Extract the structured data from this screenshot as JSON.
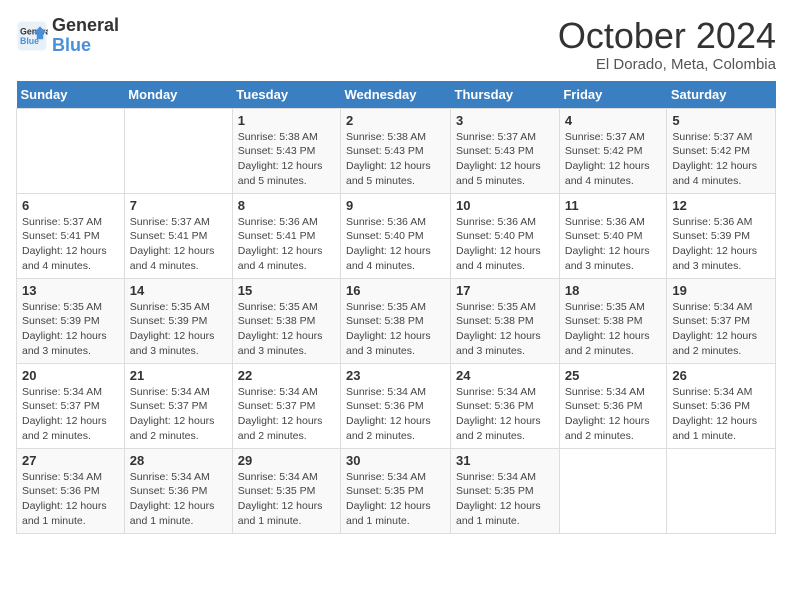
{
  "logo": {
    "line1": "General",
    "line2": "Blue"
  },
  "title": "October 2024",
  "location": "El Dorado, Meta, Colombia",
  "days_of_week": [
    "Sunday",
    "Monday",
    "Tuesday",
    "Wednesday",
    "Thursday",
    "Friday",
    "Saturday"
  ],
  "weeks": [
    [
      {
        "day": "",
        "info": ""
      },
      {
        "day": "",
        "info": ""
      },
      {
        "day": "1",
        "info": "Sunrise: 5:38 AM\nSunset: 5:43 PM\nDaylight: 12 hours and 5 minutes."
      },
      {
        "day": "2",
        "info": "Sunrise: 5:38 AM\nSunset: 5:43 PM\nDaylight: 12 hours and 5 minutes."
      },
      {
        "day": "3",
        "info": "Sunrise: 5:37 AM\nSunset: 5:43 PM\nDaylight: 12 hours and 5 minutes."
      },
      {
        "day": "4",
        "info": "Sunrise: 5:37 AM\nSunset: 5:42 PM\nDaylight: 12 hours and 4 minutes."
      },
      {
        "day": "5",
        "info": "Sunrise: 5:37 AM\nSunset: 5:42 PM\nDaylight: 12 hours and 4 minutes."
      }
    ],
    [
      {
        "day": "6",
        "info": "Sunrise: 5:37 AM\nSunset: 5:41 PM\nDaylight: 12 hours and 4 minutes."
      },
      {
        "day": "7",
        "info": "Sunrise: 5:37 AM\nSunset: 5:41 PM\nDaylight: 12 hours and 4 minutes."
      },
      {
        "day": "8",
        "info": "Sunrise: 5:36 AM\nSunset: 5:41 PM\nDaylight: 12 hours and 4 minutes."
      },
      {
        "day": "9",
        "info": "Sunrise: 5:36 AM\nSunset: 5:40 PM\nDaylight: 12 hours and 4 minutes."
      },
      {
        "day": "10",
        "info": "Sunrise: 5:36 AM\nSunset: 5:40 PM\nDaylight: 12 hours and 4 minutes."
      },
      {
        "day": "11",
        "info": "Sunrise: 5:36 AM\nSunset: 5:40 PM\nDaylight: 12 hours and 3 minutes."
      },
      {
        "day": "12",
        "info": "Sunrise: 5:36 AM\nSunset: 5:39 PM\nDaylight: 12 hours and 3 minutes."
      }
    ],
    [
      {
        "day": "13",
        "info": "Sunrise: 5:35 AM\nSunset: 5:39 PM\nDaylight: 12 hours and 3 minutes."
      },
      {
        "day": "14",
        "info": "Sunrise: 5:35 AM\nSunset: 5:39 PM\nDaylight: 12 hours and 3 minutes."
      },
      {
        "day": "15",
        "info": "Sunrise: 5:35 AM\nSunset: 5:38 PM\nDaylight: 12 hours and 3 minutes."
      },
      {
        "day": "16",
        "info": "Sunrise: 5:35 AM\nSunset: 5:38 PM\nDaylight: 12 hours and 3 minutes."
      },
      {
        "day": "17",
        "info": "Sunrise: 5:35 AM\nSunset: 5:38 PM\nDaylight: 12 hours and 3 minutes."
      },
      {
        "day": "18",
        "info": "Sunrise: 5:35 AM\nSunset: 5:38 PM\nDaylight: 12 hours and 2 minutes."
      },
      {
        "day": "19",
        "info": "Sunrise: 5:34 AM\nSunset: 5:37 PM\nDaylight: 12 hours and 2 minutes."
      }
    ],
    [
      {
        "day": "20",
        "info": "Sunrise: 5:34 AM\nSunset: 5:37 PM\nDaylight: 12 hours and 2 minutes."
      },
      {
        "day": "21",
        "info": "Sunrise: 5:34 AM\nSunset: 5:37 PM\nDaylight: 12 hours and 2 minutes."
      },
      {
        "day": "22",
        "info": "Sunrise: 5:34 AM\nSunset: 5:37 PM\nDaylight: 12 hours and 2 minutes."
      },
      {
        "day": "23",
        "info": "Sunrise: 5:34 AM\nSunset: 5:36 PM\nDaylight: 12 hours and 2 minutes."
      },
      {
        "day": "24",
        "info": "Sunrise: 5:34 AM\nSunset: 5:36 PM\nDaylight: 12 hours and 2 minutes."
      },
      {
        "day": "25",
        "info": "Sunrise: 5:34 AM\nSunset: 5:36 PM\nDaylight: 12 hours and 2 minutes."
      },
      {
        "day": "26",
        "info": "Sunrise: 5:34 AM\nSunset: 5:36 PM\nDaylight: 12 hours and 1 minute."
      }
    ],
    [
      {
        "day": "27",
        "info": "Sunrise: 5:34 AM\nSunset: 5:36 PM\nDaylight: 12 hours and 1 minute."
      },
      {
        "day": "28",
        "info": "Sunrise: 5:34 AM\nSunset: 5:36 PM\nDaylight: 12 hours and 1 minute."
      },
      {
        "day": "29",
        "info": "Sunrise: 5:34 AM\nSunset: 5:35 PM\nDaylight: 12 hours and 1 minute."
      },
      {
        "day": "30",
        "info": "Sunrise: 5:34 AM\nSunset: 5:35 PM\nDaylight: 12 hours and 1 minute."
      },
      {
        "day": "31",
        "info": "Sunrise: 5:34 AM\nSunset: 5:35 PM\nDaylight: 12 hours and 1 minute."
      },
      {
        "day": "",
        "info": ""
      },
      {
        "day": "",
        "info": ""
      }
    ]
  ]
}
